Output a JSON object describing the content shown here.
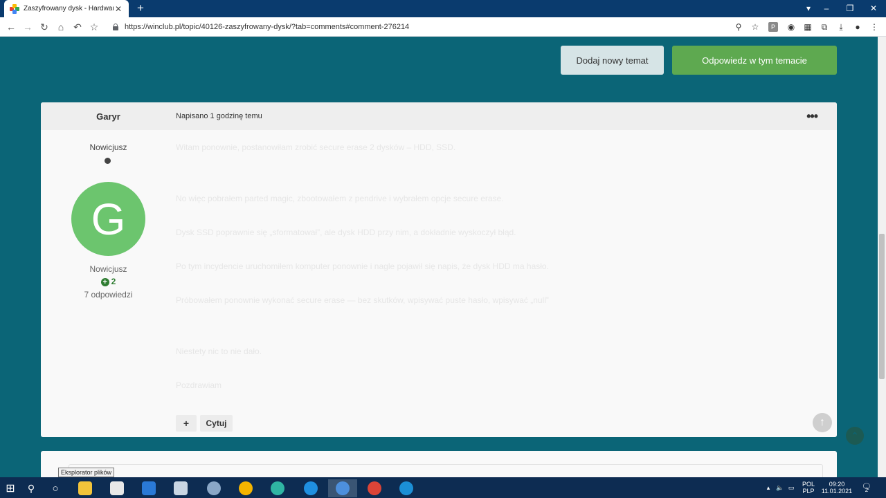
{
  "browser": {
    "tab_title": "Zaszyfrowany dysk - Hardware -",
    "tab_close": "✕",
    "new_tab": "+",
    "url": "https://winclub.pl/topic/40126-zaszyfrowany-dysk/?tab=comments#comment-276214",
    "ext_p_label": "P"
  },
  "actions": {
    "new_topic": "Dodaj nowy temat",
    "reply": "Odpowiedz w tym temacie"
  },
  "post": {
    "author": "Garyr",
    "date": "Napisano 1 godzinę temu",
    "more": "•••",
    "rank_top": "Nowicjusz",
    "avatar_letter": "G",
    "rank_bottom": "Nowicjusz",
    "reputation": "2",
    "replies": "7 odpowiedzi",
    "paragraphs": [
      "Witam ponownie, postanowiłam zrobić secure erase 2 dysków – HDD, SSD.",
      "No więc pobrałem parted magic, zbootowałem z pendrive i wybrałem opcje secure erase.",
      "Dysk SSD poprawnie się „sformatował”, ale dysk HDD przy nim, a dokładnie wyskoczył błąd.",
      "Po tym incydencie uruchomiłem komputer ponownie i nagle pojawił się napis, że dysk HDD ma hasło.",
      "Próbowałem ponownie wykonać secure erase — bez skutków, wpisywać puste hasło, wpisywać „null”",
      "Niestety nic to nie dało.",
      "Pozdrawiam"
    ],
    "quote": "Cytuj",
    "plus": "+"
  },
  "tooltip": "Eksplorator plików",
  "taskbar": {
    "lang": "POL",
    "layout": "PLP",
    "time": "09:20",
    "date": "11.01.2021",
    "notif_count": "2"
  },
  "colors": {
    "page_bg": "#0b6577",
    "tabbar": "#0a3b6e",
    "reply_green": "#5ea950",
    "avatar_green": "#6cc56e",
    "taskbar": "#0d2c52"
  }
}
